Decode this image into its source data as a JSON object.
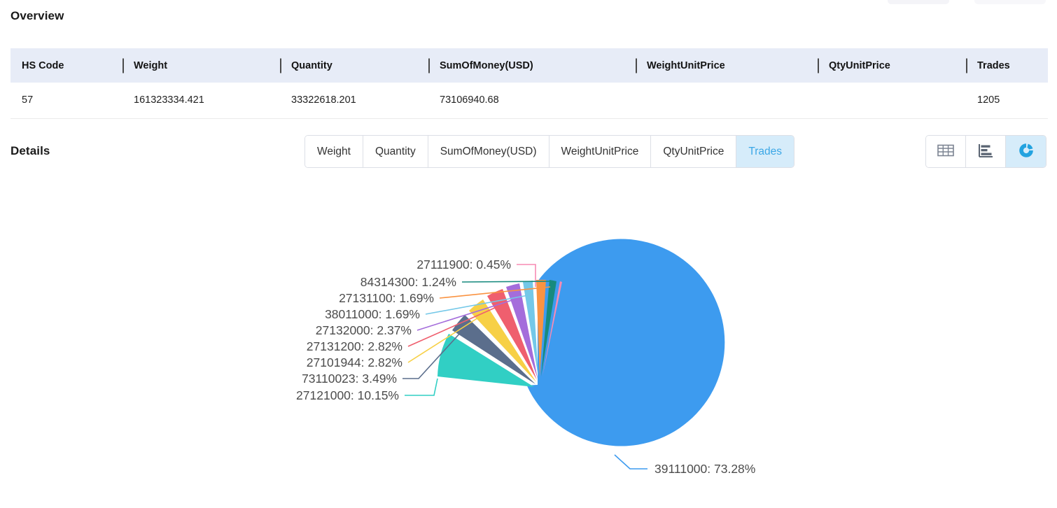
{
  "overview": {
    "title": "Overview",
    "columns": [
      "HS Code",
      "Weight",
      "Quantity",
      "SumOfMoney(USD)",
      "WeightUnitPrice",
      "QtyUnitPrice",
      "Trades"
    ],
    "rows": [
      {
        "hs_code": "57",
        "weight": "161323334.421",
        "quantity": "33322618.201",
        "sum_of_money_usd": "73106940.68",
        "weight_unit_price": "",
        "qty_unit_price": "",
        "trades": "1205"
      }
    ]
  },
  "details": {
    "title": "Details",
    "tabs": [
      {
        "label": "Weight",
        "active": false
      },
      {
        "label": "Quantity",
        "active": false
      },
      {
        "label": "SumOfMoney(USD)",
        "active": false
      },
      {
        "label": "WeightUnitPrice",
        "active": false
      },
      {
        "label": "QtyUnitPrice",
        "active": false
      },
      {
        "label": "Trades",
        "active": true
      }
    ],
    "view_buttons": [
      {
        "icon": "table-grid-icon",
        "active": false
      },
      {
        "icon": "bar-chart-icon",
        "active": false
      },
      {
        "icon": "pie-chart-icon",
        "active": true
      }
    ],
    "colors": {
      "active_tab_bg": "#d6ecfa",
      "active_tab_text": "#3ba7e6",
      "border": "#dcdfe6",
      "header_bg": "#e7ecf7"
    }
  },
  "chart_data": {
    "type": "pie",
    "title": "",
    "value_label_format": "{code}:  {percent}%",
    "legend_position": "callout-labels",
    "labels": [
      "39111000",
      "27121000",
      "73110023",
      "27101944",
      "27131200",
      "27132000",
      "38011000",
      "27131100",
      "84314300",
      "27111900"
    ],
    "percentages": [
      73.28,
      10.15,
      3.49,
      2.82,
      2.82,
      2.37,
      1.69,
      1.69,
      1.24,
      0.45
    ],
    "colors": [
      "#3d9bef",
      "#31cfc4",
      "#5b6e8c",
      "#f7d046",
      "#ef5f6e",
      "#a濃"
    ],
    "slice_colors": [
      "#3d9bef",
      "#31cfc4",
      "#5b6e8c",
      "#f7d046",
      "#ef5f6e",
      "#a46ddb",
      "#74c8e8",
      "#fa9341",
      "#178a7e",
      "#f78bb4"
    ],
    "callouts": [
      {
        "text": "27111900:  0.45%",
        "color": "#f78bb4"
      },
      {
        "text": "84314300:  1.24%",
        "color": "#178a7e"
      },
      {
        "text": "27131100:  1.69%",
        "color": "#fa9341"
      },
      {
        "text": "38011000:  1.69%",
        "color": "#74c8e8"
      },
      {
        "text": "27132000:  2.37%",
        "color": "#a46ddb"
      },
      {
        "text": "27131200:  2.82%",
        "color": "#ef5f6e"
      },
      {
        "text": "27101944:  2.82%",
        "color": "#f7d046"
      },
      {
        "text": "73110023:  3.49%",
        "color": "#5b6e8c"
      },
      {
        "text": "27121000:  10.15%",
        "color": "#31cfc4"
      },
      {
        "text": "39111000:  73.28%",
        "color": "#3d9bef"
      }
    ]
  }
}
